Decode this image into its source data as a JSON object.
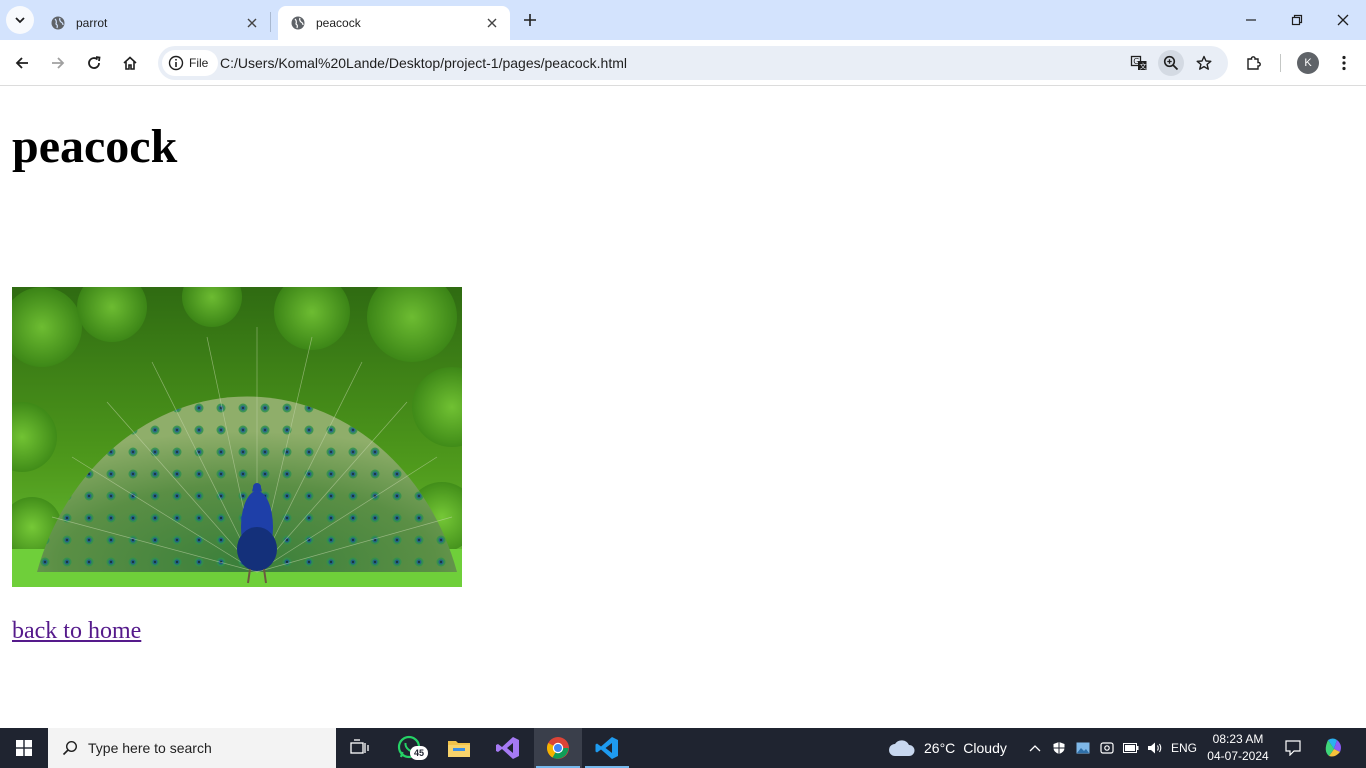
{
  "browser": {
    "tabs": [
      {
        "title": "parrot",
        "favicon": "globe-icon",
        "active": false
      },
      {
        "title": "peacock",
        "favicon": "globe-icon",
        "active": true
      }
    ],
    "omnibox": {
      "chip_label": "File",
      "url": "C:/Users/Komal%20Lande/Desktop/project-1/pages/peacock.html"
    },
    "profile_initial": "K"
  },
  "page": {
    "heading": "peacock",
    "image_alt": "peacock",
    "link_text": "back to home"
  },
  "taskbar": {
    "search_placeholder": "Type here to search",
    "whatsapp_badge": "45",
    "weather": {
      "temperature": "26°C",
      "condition": "Cloudy"
    },
    "language": "ENG",
    "time": "08:23 AM",
    "date": "04-07-2024"
  },
  "colors": {
    "tabstrip_bg": "#d3e3fd",
    "omnibox_bg": "#e9eef6",
    "link_visited": "#551a8b",
    "taskbar_bg": "#1f2430"
  }
}
